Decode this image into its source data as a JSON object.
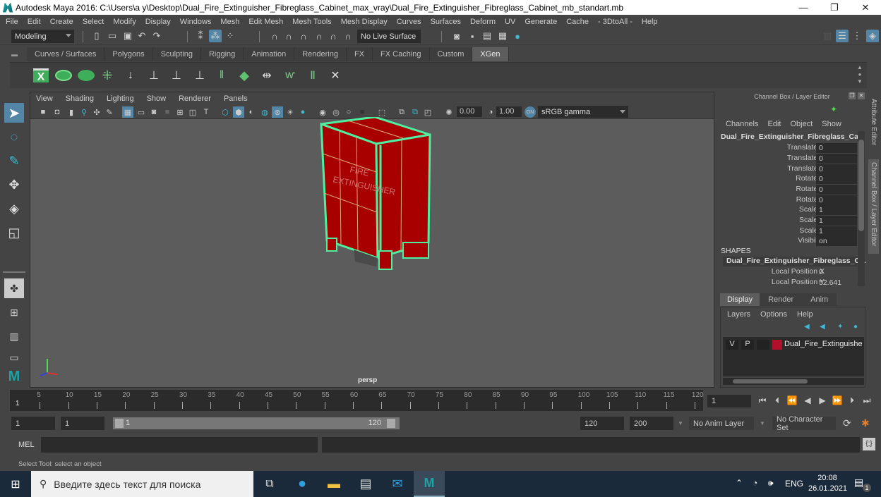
{
  "window": {
    "title": "Autodesk Maya 2016: C:\\Users\\a y\\Desktop\\Dual_Fire_Extinguisher_Fibreglass_Cabinet_max_vray\\Dual_Fire_Extinguisher_Fibreglass_Cabinet_mb_standart.mb",
    "minimize": "—",
    "restore": "❐",
    "close": "✕"
  },
  "menubar": [
    "File",
    "Edit",
    "Create",
    "Select",
    "Modify",
    "Display",
    "Windows",
    "Mesh",
    "Edit Mesh",
    "Mesh Tools",
    "Mesh Display",
    "Curves",
    "Surfaces",
    "Deform",
    "UV",
    "Generate",
    "Cache",
    "- 3DtoAll -",
    "Help"
  ],
  "statusline": {
    "menuset": "Modeling",
    "live_surface": "No Live Surface"
  },
  "shelf": {
    "tabs": [
      "Curves / Surfaces",
      "Polygons",
      "Sculpting",
      "Rigging",
      "Animation",
      "Rendering",
      "FX",
      "FX Caching",
      "Custom",
      "XGen"
    ],
    "active_tab": "XGen",
    "icons": [
      "xgen-x-icon",
      "xgen-preview-icon",
      "xgen-hide-icon",
      "xgen-add-guides-icon",
      "xgen-move-guides-icon",
      "xgen-add-guide-icon",
      "xgen-show-guide-icon",
      "xgen-lock-guide-icon",
      "xgen-guides-icon",
      "xgen-layer-icon",
      "xgen-length-icon",
      "xgen-select-icon",
      "xgen-clump-icon",
      "xgen-delete-icon"
    ]
  },
  "viewport": {
    "menu": [
      "View",
      "Shading",
      "Lighting",
      "Show",
      "Renderer",
      "Panels"
    ],
    "exposure": "0.00",
    "gamma": "1.00",
    "color_space": "sRGB gamma",
    "camera_label": "persp",
    "model_label_line1": "FIRE",
    "model_label_line2": "EXTINGUISHER",
    "model_color": "#a80000",
    "wire_color": "#4df0a0"
  },
  "channelbox": {
    "title": "Channel Box / Layer Editor",
    "menu": [
      "Channels",
      "Edit",
      "Object",
      "Show"
    ],
    "object_name": "Dual_Fire_Extinguisher_Fibreglass_Ca...",
    "channels": [
      {
        "label": "Translate X",
        "value": "0"
      },
      {
        "label": "Translate Y",
        "value": "0"
      },
      {
        "label": "Translate Z",
        "value": "0"
      },
      {
        "label": "Rotate X",
        "value": "0"
      },
      {
        "label": "Rotate Y",
        "value": "0"
      },
      {
        "label": "Rotate Z",
        "value": "0"
      },
      {
        "label": "Scale X",
        "value": "1"
      },
      {
        "label": "Scale Y",
        "value": "1"
      },
      {
        "label": "Scale Z",
        "value": "1"
      },
      {
        "label": "Visibility",
        "value": "on"
      }
    ],
    "shapes_header": "SHAPES",
    "shape_name": "Dual_Fire_Extinguisher_Fibreglass_C...",
    "shape_channels": [
      {
        "label": "Local Position X",
        "value": "0"
      },
      {
        "label": "Local Position Y",
        "value": "52.641"
      }
    ]
  },
  "layereditor": {
    "tabs": [
      "Display",
      "Render",
      "Anim"
    ],
    "active_tab": "Display",
    "menu": [
      "Layers",
      "Options",
      "Help"
    ],
    "layer": {
      "v": "V",
      "p": "P",
      "name": "Dual_Fire_Extinguisher_F",
      "color": "#b0102a"
    }
  },
  "sidetabs": {
    "attribute_editor": "Attribute Editor",
    "channel_box": "Channel Box / Layer Editor"
  },
  "timeline": {
    "ticks": [
      5,
      10,
      15,
      20,
      25,
      30,
      35,
      40,
      45,
      50,
      55,
      60,
      65,
      70,
      75,
      80,
      85,
      90,
      95,
      100,
      105,
      110,
      115,
      120
    ],
    "current_frame_marker": "1",
    "current_frame": "1"
  },
  "range": {
    "start": "1",
    "playback_start": "1",
    "slider_start": "1",
    "slider_end": "120",
    "playback_end": "120",
    "end": "200",
    "anim_layer": "No Anim Layer",
    "character_set": "No Character Set"
  },
  "cmdline": {
    "label": "MEL",
    "help": "Select Tool: select an object"
  },
  "taskbar": {
    "search_placeholder": "Введите здесь текст для поиска",
    "lang": "ENG",
    "time": "20:08",
    "date": "26.01.2021",
    "notifications": "1"
  }
}
